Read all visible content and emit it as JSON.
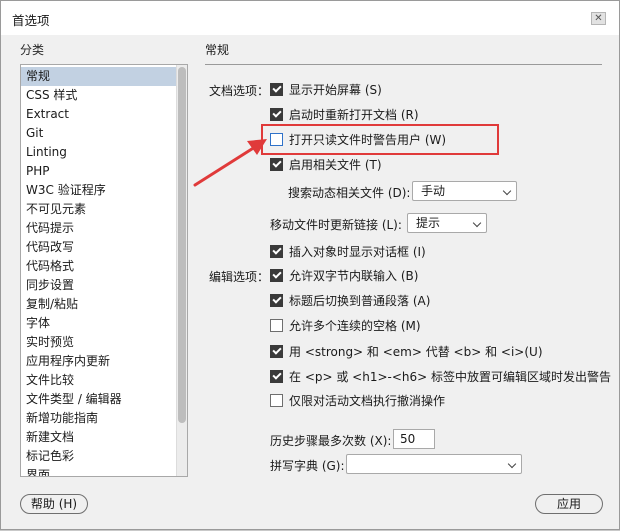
{
  "window": {
    "title": "首选项",
    "close_glyph": "✕"
  },
  "sidebar": {
    "label": "分类",
    "items": [
      {
        "label": "常规",
        "selected": true
      },
      {
        "label": "CSS 样式"
      },
      {
        "label": "Extract"
      },
      {
        "label": "Git"
      },
      {
        "label": "Linting"
      },
      {
        "label": "PHP"
      },
      {
        "label": "W3C 验证程序"
      },
      {
        "label": "不可见元素"
      },
      {
        "label": "代码提示"
      },
      {
        "label": "代码改写"
      },
      {
        "label": "代码格式"
      },
      {
        "label": "同步设置"
      },
      {
        "label": "复制/粘贴"
      },
      {
        "label": "字体"
      },
      {
        "label": "实时预览"
      },
      {
        "label": "应用程序内更新"
      },
      {
        "label": "文件比较"
      },
      {
        "label": "文件类型 / 编辑器"
      },
      {
        "label": "新增功能指南"
      },
      {
        "label": "新建文档"
      },
      {
        "label": "标记色彩"
      },
      {
        "label": "界面"
      }
    ]
  },
  "main": {
    "title": "常规",
    "doc_group_label": "文档选项：",
    "doc_options": [
      {
        "label": "显示开始屏幕 (S)",
        "checked": true
      },
      {
        "label": "启动时重新打开文档 (R)",
        "checked": true
      },
      {
        "label": "打开只读文件时警告用户 (W)",
        "checked": false
      },
      {
        "label": "启用相关文件 (T)",
        "checked": true
      }
    ],
    "related_files": {
      "label": "搜索动态相关文件 (D):",
      "value": "手动"
    },
    "update_links": {
      "label": "移动文件时更新链接 (L):",
      "value": "提示"
    },
    "show_dialog": {
      "label": "插入对象时显示对话框 (I)",
      "checked": true
    },
    "edit_group_label": "编辑选项：",
    "edit_options": [
      {
        "label": "允许双字节内联输入 (B)",
        "checked": true
      },
      {
        "label": "标题后切换到普通段落 (A)",
        "checked": true
      },
      {
        "label": "允许多个连续的空格 (M)",
        "checked": false
      },
      {
        "label": "用 <strong> 和 <em> 代替 <b> 和 <i>(U)",
        "checked": true
      },
      {
        "label": "在 <p> 或 <h1>-<h6> 标签中放置可编辑区域时发出警告",
        "checked": true
      },
      {
        "label": "仅限对活动文档执行撤消操作",
        "checked": false
      }
    ],
    "history": {
      "label": "历史步骤最多次数 (X):",
      "value": "50"
    },
    "spell": {
      "label": "拼写字典 (G):",
      "value": ""
    }
  },
  "footer": {
    "help_label": "帮助 (H)",
    "apply_label": "应用"
  },
  "colors": {
    "annotation": "#e03a3a",
    "selected_row": "#c2d1e2",
    "checkbox_checked": "#3a3a3a"
  }
}
